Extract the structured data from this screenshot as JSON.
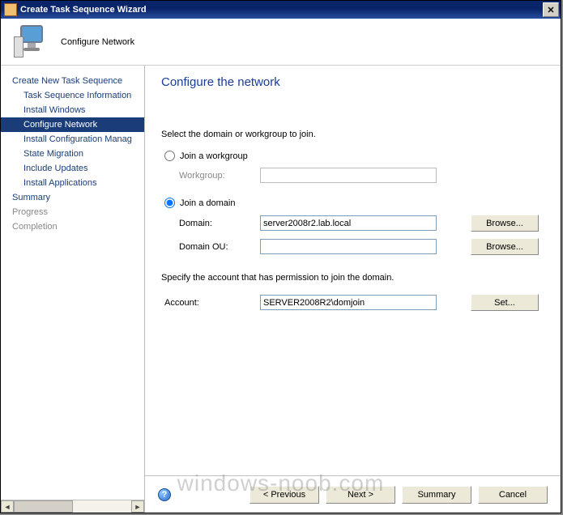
{
  "window": {
    "title": "Create Task Sequence Wizard"
  },
  "header": {
    "label": "Configure Network"
  },
  "sidebar": {
    "items": [
      {
        "label": "Create New Task Sequence",
        "sub": false,
        "selected": false,
        "disabled": false
      },
      {
        "label": "Task Sequence Information",
        "sub": true,
        "selected": false,
        "disabled": false
      },
      {
        "label": "Install Windows",
        "sub": true,
        "selected": false,
        "disabled": false
      },
      {
        "label": "Configure Network",
        "sub": true,
        "selected": true,
        "disabled": false
      },
      {
        "label": "Install Configuration Manag",
        "sub": true,
        "selected": false,
        "disabled": false
      },
      {
        "label": "State Migration",
        "sub": true,
        "selected": false,
        "disabled": false
      },
      {
        "label": "Include Updates",
        "sub": true,
        "selected": false,
        "disabled": false
      },
      {
        "label": "Install Applications",
        "sub": true,
        "selected": false,
        "disabled": false
      },
      {
        "label": "Summary",
        "sub": false,
        "selected": false,
        "disabled": false
      },
      {
        "label": "Progress",
        "sub": false,
        "selected": false,
        "disabled": true
      },
      {
        "label": "Completion",
        "sub": false,
        "selected": false,
        "disabled": true
      }
    ]
  },
  "main": {
    "title": "Configure the network",
    "instruction": "Select the domain or workgroup to join.",
    "workgroup": {
      "option_label": "Join a workgroup",
      "field_label": "Workgroup:",
      "value": ""
    },
    "domain": {
      "option_label": "Join a domain",
      "field_label": "Domain:",
      "value": "server2008r2.lab.local",
      "ou_label": "Domain OU:",
      "ou_value": "",
      "browse_label": "Browse..."
    },
    "account": {
      "instruction": "Specify the account that has permission to join the domain.",
      "field_label": "Account:",
      "value": "SERVER2008R2\\domjoin",
      "set_label": "Set..."
    }
  },
  "footer": {
    "previous": "< Previous",
    "next": "Next >",
    "summary": "Summary",
    "cancel": "Cancel"
  },
  "watermark": "windows-noob.com"
}
